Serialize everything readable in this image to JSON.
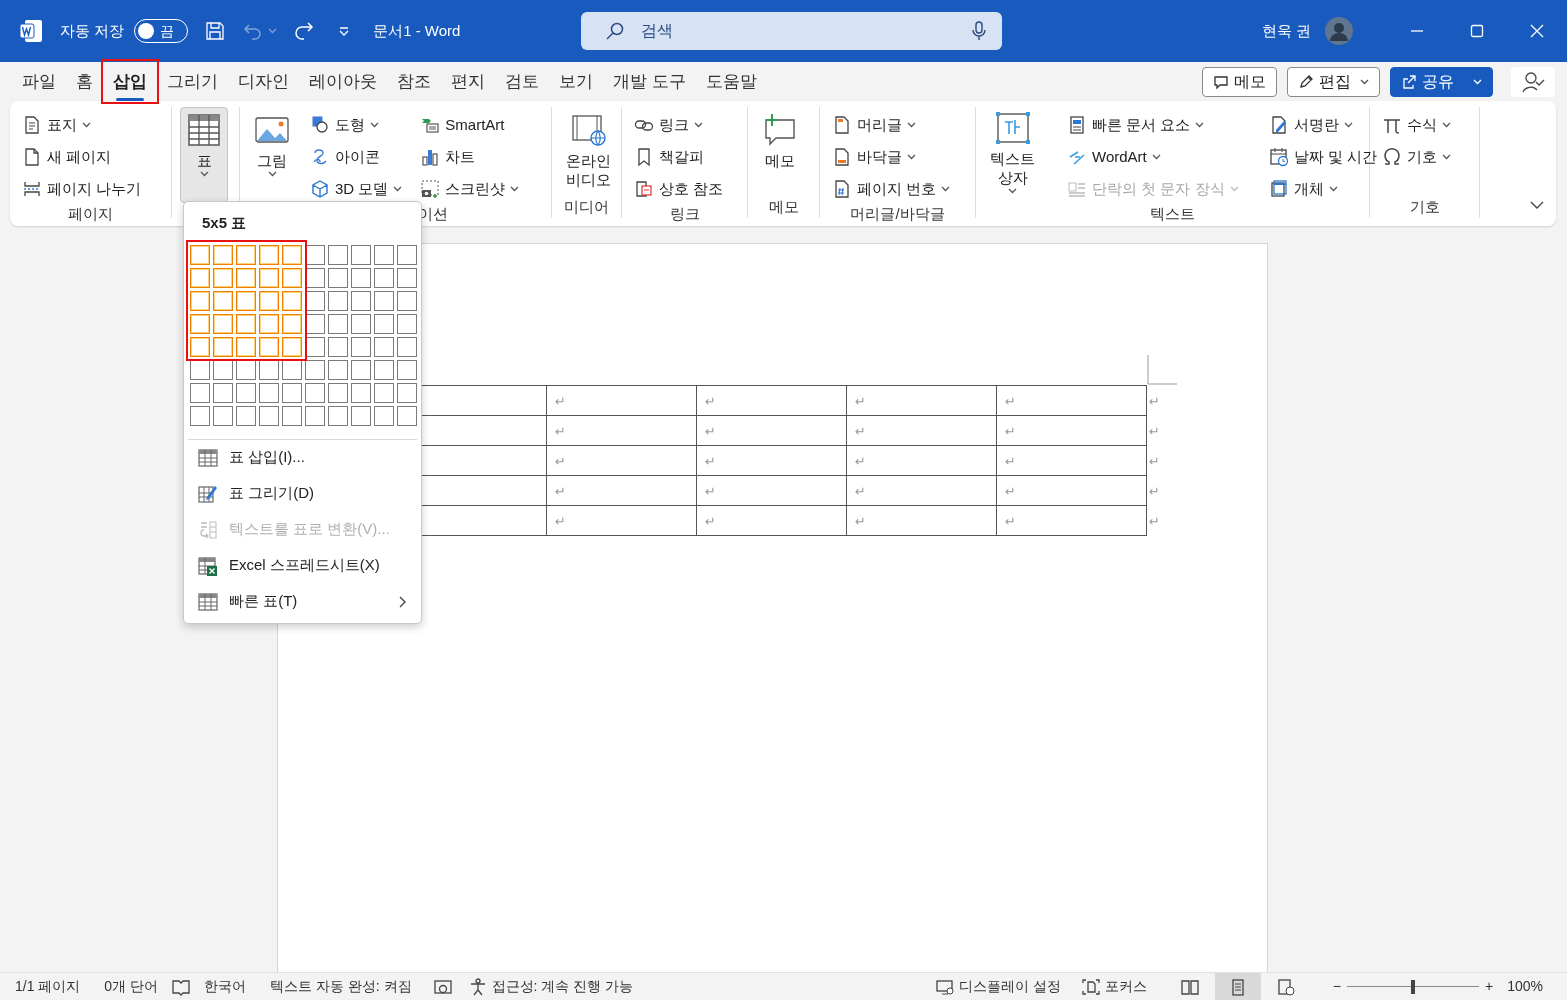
{
  "title_bar": {
    "autosave": {
      "label": "자동 저장",
      "on": false,
      "state_text": "끔"
    },
    "undo_disabled": true,
    "document_title": "문서1 - Word",
    "search": {
      "placeholder": "검색"
    },
    "user_name": "현욱 권"
  },
  "tabs": [
    {
      "label": "파일",
      "selected": false,
      "highlighted": false
    },
    {
      "label": "홈",
      "selected": false,
      "highlighted": false
    },
    {
      "label": "삽입",
      "selected": true,
      "highlighted": true
    },
    {
      "label": "그리기",
      "selected": false,
      "highlighted": false
    },
    {
      "label": "디자인",
      "selected": false,
      "highlighted": false
    },
    {
      "label": "레이아웃",
      "selected": false,
      "highlighted": false
    },
    {
      "label": "참조",
      "selected": false,
      "highlighted": false
    },
    {
      "label": "편지",
      "selected": false,
      "highlighted": false
    },
    {
      "label": "검토",
      "selected": false,
      "highlighted": false
    },
    {
      "label": "보기",
      "selected": false,
      "highlighted": false
    },
    {
      "label": "개발 도구",
      "selected": false,
      "highlighted": false
    },
    {
      "label": "도움말",
      "selected": false,
      "highlighted": false
    }
  ],
  "tab_actions": [
    {
      "label": "메모",
      "dropdown": false,
      "primary": false
    },
    {
      "label": "편집",
      "dropdown": true,
      "primary": false
    },
    {
      "label": "공유",
      "dropdown": true,
      "primary": true
    }
  ],
  "ribbon": {
    "groups": [
      {
        "label": "페이지",
        "columns": [
          {
            "kind": "stack",
            "items": [
              {
                "label": "표지",
                "dropdown": true,
                "disabled": false
              },
              {
                "label": "새 페이지",
                "dropdown": false,
                "disabled": false
              },
              {
                "label": "페이지 나누기",
                "dropdown": false,
                "disabled": false
              }
            ]
          }
        ]
      },
      {
        "columns": [
          {
            "kind": "large",
            "label": "표",
            "dropdown": true,
            "pressed": true
          }
        ]
      },
      {
        "label": "이션",
        "columns": [
          {
            "kind": "large",
            "label": "그림",
            "dropdown": true,
            "pressed": false
          },
          {
            "kind": "stack",
            "items": [
              {
                "label": "도형",
                "dropdown": true,
                "disabled": false
              },
              {
                "label": "아이콘",
                "dropdown": false,
                "disabled": false
              },
              {
                "label": "3D 모델",
                "dropdown": true,
                "disabled": false
              }
            ]
          },
          {
            "kind": "stack",
            "items": [
              {
                "label": "SmartArt",
                "dropdown": false,
                "disabled": false
              },
              {
                "label": "차트",
                "dropdown": false,
                "disabled": false
              },
              {
                "label": "스크린샷",
                "dropdown": true,
                "disabled": false
              }
            ]
          }
        ]
      },
      {
        "label": "미디어",
        "columns": [
          {
            "kind": "large",
            "label": "온라인 비디오",
            "dropdown": false,
            "pressed": false
          }
        ]
      },
      {
        "label": "링크",
        "columns": [
          {
            "kind": "stack",
            "items": [
              {
                "label": "링크",
                "dropdown": true,
                "disabled": false
              },
              {
                "label": "책갈피",
                "dropdown": false,
                "disabled": false
              },
              {
                "label": "상호 참조",
                "dropdown": false,
                "disabled": false
              }
            ]
          }
        ]
      },
      {
        "label": "메모",
        "columns": [
          {
            "kind": "large",
            "label": "메모",
            "dropdown": false,
            "pressed": false
          }
        ]
      },
      {
        "label": "머리글/바닥글",
        "columns": [
          {
            "kind": "stack",
            "items": [
              {
                "label": "머리글",
                "dropdown": true,
                "disabled": false
              },
              {
                "label": "바닥글",
                "dropdown": true,
                "disabled": false
              },
              {
                "label": "페이지 번호",
                "dropdown": true,
                "disabled": false
              }
            ]
          }
        ]
      },
      {
        "label": "텍스트",
        "columns": [
          {
            "kind": "large",
            "label": "텍스트 상자",
            "dropdown": true,
            "pressed": false
          },
          {
            "kind": "stack",
            "items": [
              {
                "label": "빠른 문서 요소",
                "dropdown": true,
                "disabled": false
              },
              {
                "label": "WordArt",
                "dropdown": true,
                "disabled": false
              },
              {
                "label": "단락의 첫 문자 장식",
                "dropdown": true,
                "disabled": true
              }
            ]
          },
          {
            "kind": "stack",
            "items": [
              {
                "label": "서명란",
                "dropdown": true,
                "disabled": false
              },
              {
                "label": "날짜 및 시간",
                "dropdown": false,
                "disabled": false
              },
              {
                "label": "개체",
                "dropdown": true,
                "disabled": false
              }
            ]
          }
        ]
      },
      {
        "label": "기호",
        "columns": [
          {
            "kind": "stack",
            "items": [
              {
                "label": "수식",
                "dropdown": true,
                "disabled": false
              },
              {
                "label": "기호",
                "dropdown": true,
                "disabled": false
              }
            ]
          }
        ]
      }
    ]
  },
  "table_picker": {
    "title": "5x5 표",
    "highlighted": true,
    "grid": [
      {
        "cells": [
          {
            "selected": true
          },
          {
            "selected": true
          },
          {
            "selected": true
          },
          {
            "selected": true
          },
          {
            "selected": true
          },
          {
            "selected": false
          },
          {
            "selected": false
          },
          {
            "selected": false
          },
          {
            "selected": false
          },
          {
            "selected": false
          }
        ]
      },
      {
        "cells": [
          {
            "selected": true
          },
          {
            "selected": true
          },
          {
            "selected": true
          },
          {
            "selected": true
          },
          {
            "selected": true
          },
          {
            "selected": false
          },
          {
            "selected": false
          },
          {
            "selected": false
          },
          {
            "selected": false
          },
          {
            "selected": false
          }
        ]
      },
      {
        "cells": [
          {
            "selected": true
          },
          {
            "selected": true
          },
          {
            "selected": true
          },
          {
            "selected": true
          },
          {
            "selected": true
          },
          {
            "selected": false
          },
          {
            "selected": false
          },
          {
            "selected": false
          },
          {
            "selected": false
          },
          {
            "selected": false
          }
        ]
      },
      {
        "cells": [
          {
            "selected": true
          },
          {
            "selected": true
          },
          {
            "selected": true
          },
          {
            "selected": true
          },
          {
            "selected": true
          },
          {
            "selected": false
          },
          {
            "selected": false
          },
          {
            "selected": false
          },
          {
            "selected": false
          },
          {
            "selected": false
          }
        ]
      },
      {
        "cells": [
          {
            "selected": true
          },
          {
            "selected": true
          },
          {
            "selected": true
          },
          {
            "selected": true
          },
          {
            "selected": true
          },
          {
            "selected": false
          },
          {
            "selected": false
          },
          {
            "selected": false
          },
          {
            "selected": false
          },
          {
            "selected": false
          }
        ]
      },
      {
        "cells": [
          {
            "selected": false
          },
          {
            "selected": false
          },
          {
            "selected": false
          },
          {
            "selected": false
          },
          {
            "selected": false
          },
          {
            "selected": false
          },
          {
            "selected": false
          },
          {
            "selected": false
          },
          {
            "selected": false
          },
          {
            "selected": false
          }
        ]
      },
      {
        "cells": [
          {
            "selected": false
          },
          {
            "selected": false
          },
          {
            "selected": false
          },
          {
            "selected": false
          },
          {
            "selected": false
          },
          {
            "selected": false
          },
          {
            "selected": false
          },
          {
            "selected": false
          },
          {
            "selected": false
          },
          {
            "selected": false
          }
        ]
      },
      {
        "cells": [
          {
            "selected": false
          },
          {
            "selected": false
          },
          {
            "selected": false
          },
          {
            "selected": false
          },
          {
            "selected": false
          },
          {
            "selected": false
          },
          {
            "selected": false
          },
          {
            "selected": false
          },
          {
            "selected": false
          },
          {
            "selected": false
          }
        ]
      }
    ],
    "items": [
      {
        "label": "표 삽입(I)...",
        "disabled": false,
        "submenu": false
      },
      {
        "label": "표 그리기(D)",
        "disabled": false,
        "submenu": false
      },
      {
        "label": "텍스트를 표로 변환(V)...",
        "disabled": true,
        "submenu": false
      },
      {
        "label": "Excel 스프레드시트(X)",
        "disabled": false,
        "submenu": false
      },
      {
        "label": "빠른 표(T)",
        "disabled": false,
        "submenu": true
      }
    ]
  },
  "document": {
    "table": {
      "rows": [
        {
          "cells": [
            "↵",
            "↵",
            "↵",
            "↵"
          ],
          "end_mark": "↵"
        },
        {
          "cells": [
            "↵",
            "↵",
            "↵",
            "↵"
          ],
          "end_mark": "↵"
        },
        {
          "cells": [
            "↵",
            "↵",
            "↵",
            "↵"
          ],
          "end_mark": "↵"
        },
        {
          "cells": [
            "↵",
            "↵",
            "↵",
            "↵"
          ],
          "end_mark": "↵"
        },
        {
          "cells": [
            "↵",
            "↵",
            "↵",
            "↵"
          ],
          "end_mark": "↵"
        }
      ]
    }
  },
  "status_bar": {
    "page": "1/1 페이지",
    "words": "0개 단어",
    "language": "한국어",
    "autocomplete": "텍스트 자동 완성: 켜짐",
    "accessibility": "접근성: 계속 진행 가능",
    "display_settings": "디스플레이 설정",
    "focus": "포커스",
    "views": [
      {
        "selected": false
      },
      {
        "selected": true
      },
      {
        "selected": false
      }
    ],
    "zoom": {
      "zoom_out": "−",
      "level": 0.5,
      "zoom_in": "+",
      "reading": "100%"
    }
  }
}
